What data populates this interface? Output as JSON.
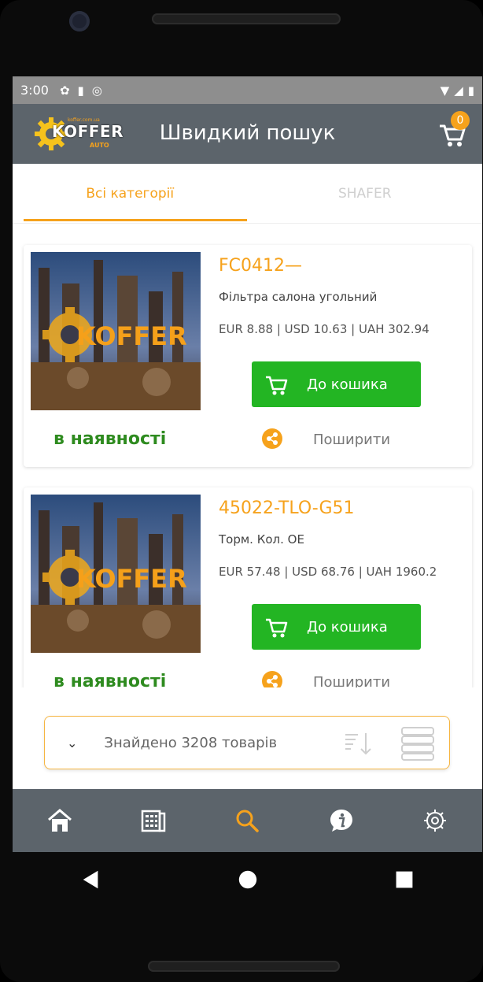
{
  "status_bar": {
    "time": "3:00"
  },
  "app_bar": {
    "logo_text": "KOFFER",
    "logo_sub": "AUTO",
    "logo_site": "koffer.com.ua",
    "title": "Швидкий пошук",
    "cart_count": "0"
  },
  "tabs": [
    {
      "label": "Всі категорії"
    },
    {
      "label": "SHAFER"
    }
  ],
  "products": [
    {
      "code": "FC0412—",
      "name": "Фільтра салона угольний",
      "price": "EUR 8.88 | USD 10.63 | UAH 302.94",
      "add_label": "До кошика",
      "stock": "в наявності",
      "share_label": "Поширити",
      "image_text": "KOFFER"
    },
    {
      "code": "45022-TLO-G51",
      "name": "Торм. Кол. OE",
      "price": "EUR 57.48 | USD 68.76 | UAH 1960.2",
      "add_label": "До кошика",
      "stock": "в наявності",
      "share_label": "Поширити",
      "image_text": "KOFFER"
    }
  ],
  "found_bar": {
    "text": "Знайдено 3208 товарів"
  },
  "colors": {
    "accent": "#f6a21c",
    "appbar": "#5c646b",
    "green": "#23b523",
    "stock": "#2e8b1f"
  },
  "bottom_nav": [
    "home-icon",
    "catalog-icon",
    "search-icon",
    "info-icon",
    "settings-icon"
  ]
}
